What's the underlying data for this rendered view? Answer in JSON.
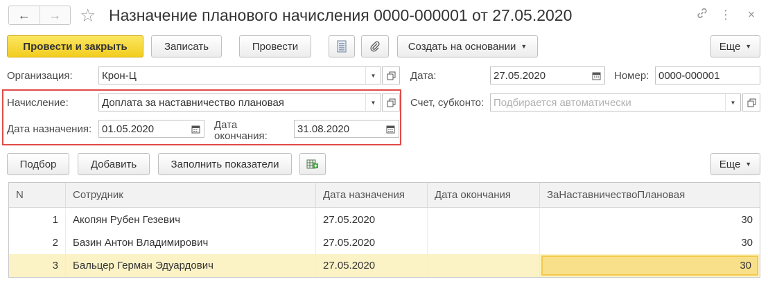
{
  "window": {
    "title": "Назначение планового начисления 0000-000001 от 27.05.2020",
    "nav_back": "←",
    "nav_forward": "→",
    "favorite_icon": "star-outline",
    "link_icon": "link-icon",
    "more_icon": "⋮",
    "close_icon": "×"
  },
  "toolbar": {
    "post_and_close": "Провести и закрыть",
    "save": "Записать",
    "post": "Провести",
    "create_based_on": "Создать на основании",
    "more": "Еще"
  },
  "form": {
    "organization_label": "Организация:",
    "organization_value": "Крон-Ц",
    "date_label": "Дата:",
    "date_value": "27.05.2020",
    "number_label": "Номер:",
    "number_value": "0000-000001",
    "accrual_label": "Начисление:",
    "accrual_value": "Доплата за наставничество плановая",
    "account_label": "Счет, субконто:",
    "account_placeholder": "Подбирается автоматически",
    "start_date_label": "Дата назначения:",
    "start_date_value": "01.05.2020",
    "end_date_label_1": "Дата",
    "end_date_label_2": "окончания:",
    "end_date_value": "31.08.2020"
  },
  "table_toolbar": {
    "pick": "Подбор",
    "add": "Добавить",
    "fill": "Заполнить показатели",
    "more": "Еще"
  },
  "table": {
    "columns": [
      "N",
      "Сотрудник",
      "Дата назначения",
      "Дата окончания",
      "ЗаНаставничествоПлановая"
    ],
    "rows": [
      {
        "n": "1",
        "employee": "Акопян Рубен Гезевич",
        "start": "27.05.2020",
        "end": "",
        "value": "30"
      },
      {
        "n": "2",
        "employee": "Базин Антон Владимирович",
        "start": "27.05.2020",
        "end": "",
        "value": "30"
      },
      {
        "n": "3",
        "employee": "Бальцер Герман Эдуардович",
        "start": "27.05.2020",
        "end": "",
        "value": "30"
      }
    ],
    "selected_row": 3
  },
  "colors": {
    "primary_button": "#f2cd1f",
    "highlight_border": "#e14b48",
    "selected_row": "#fbf2c6",
    "active_cell": "#f8e08a"
  }
}
